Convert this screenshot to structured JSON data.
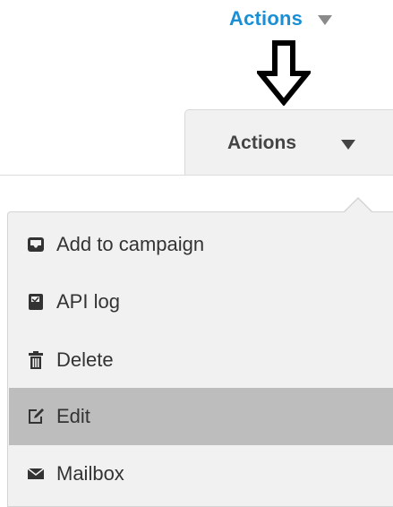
{
  "top_button": {
    "label": "Actions",
    "caret_icon": "caret-down-icon",
    "color": "#1a8fd6"
  },
  "annotation": {
    "icon": "arrow-down-icon"
  },
  "tab_button": {
    "label": "Actions",
    "caret_icon": "caret-down-icon"
  },
  "menu": {
    "items": [
      {
        "label": "Add to campaign",
        "icon": "inbox-icon",
        "active": false
      },
      {
        "label": "API log",
        "icon": "log-icon",
        "active": false
      },
      {
        "label": "Delete",
        "icon": "trash-icon",
        "active": false
      },
      {
        "label": "Edit",
        "icon": "edit-icon",
        "active": true
      },
      {
        "label": "Mailbox",
        "icon": "envelope-icon",
        "active": false
      }
    ]
  }
}
